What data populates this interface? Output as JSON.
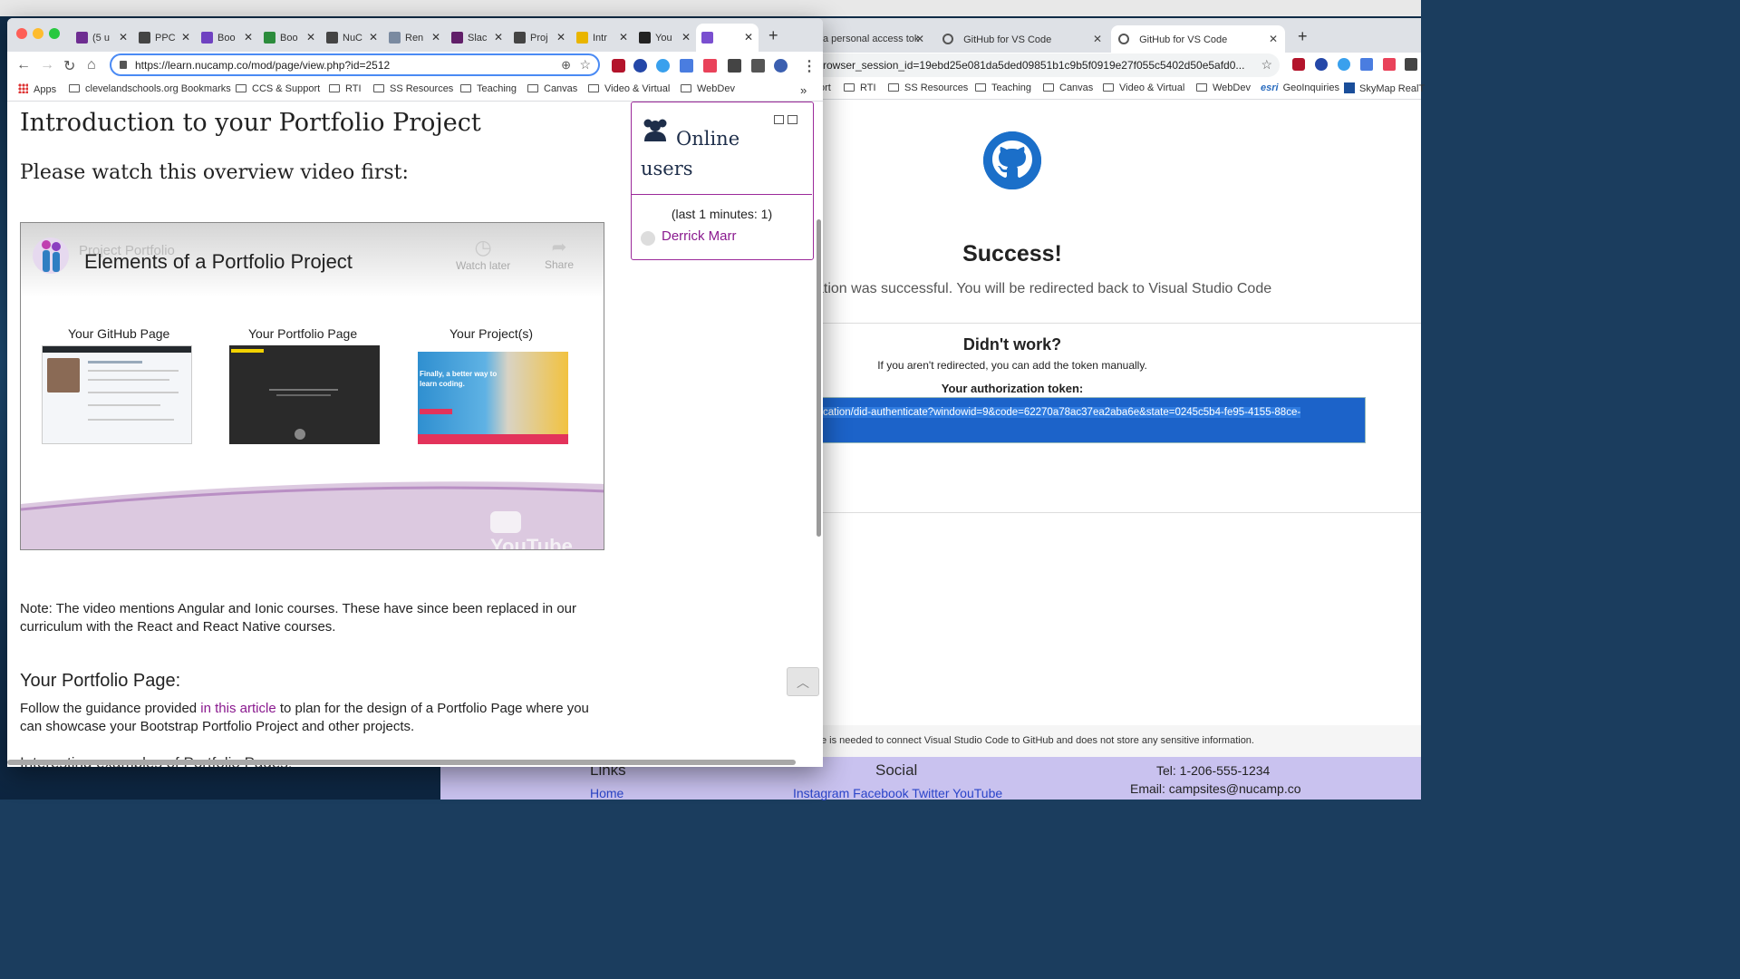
{
  "left_window": {
    "tabs": [
      {
        "label": "(5 u",
        "color": "#6e2d91"
      },
      {
        "label": "PPC",
        "color": "#444444"
      },
      {
        "label": "Boo",
        "color": "#6f42c1"
      },
      {
        "label": "Boo",
        "color": "#2c8c3c"
      },
      {
        "label": "NuC",
        "color": "#444444"
      },
      {
        "label": "Ren",
        "color": "#7a8aa0"
      },
      {
        "label": "Slac",
        "color": "#611f69"
      },
      {
        "label": "Proj",
        "color": "#444444"
      },
      {
        "label": "Intr",
        "color": "#e9b500"
      },
      {
        "label": "You",
        "color": "#222222"
      },
      {
        "label": "",
        "color": "#7a4fd0"
      }
    ],
    "url": "https://learn.nucamp.co/mod/page/view.php?id=2512",
    "bookmarks": {
      "apps": "Apps",
      "items": [
        "clevelandschools.org Bookmarks",
        "CCS & Support",
        "RTI",
        "SS Resources",
        "Teaching",
        "Canvas",
        "Video & Virtual",
        "WebDev"
      ],
      "more": "»"
    },
    "page": {
      "title": "Introduction to your Portfolio Project",
      "subtitle": "Please watch this overview video first:",
      "video": {
        "title": "Elements of a Portfolio Project",
        "ghost_title": "Project Portfolio",
        "watch_later": "Watch later",
        "share": "Share",
        "captions": [
          "Your GitHub Page",
          "Your Portfolio Page",
          "Your Project(s)"
        ],
        "youtube": "YouTube",
        "thumb3_text": "Finally, a better way to learn coding."
      },
      "note": "Note: The video mentions Angular and Ionic courses. These have since been replaced in our curriculum with the React and React Native courses.",
      "section_title": "Your Portfolio Page:",
      "follow_before": "Follow the guidance provided ",
      "follow_link": "in this article",
      "follow_after": " to plan for the design of a Portfolio Page where you can showcase your Bootstrap Portfolio Project and other projects.",
      "next_heading": "Interesting examples of Portfolio Pages:"
    },
    "online_users": {
      "title_line1": "Online",
      "title_line2": "users",
      "last": "(last 1 minutes: 1)",
      "user": "Derrick Marr"
    }
  },
  "right_window": {
    "tabs": [
      {
        "label": "a personal access tok"
      },
      {
        "label": "GitHub for VS Code"
      },
      {
        "label": "GitHub for VS Code"
      }
    ],
    "url": "rowser_session_id=19ebd25e081da5ded09851b1c9b5f0919e27f055c5402d50e5afd0...",
    "bookmarks": [
      "ort",
      "RTI",
      "SS Resources",
      "Teaching",
      "Canvas",
      "Video & Virtual",
      "WebDev",
      "GeoInquiries",
      "SkyMap RealT"
    ],
    "esri": "esri",
    "success": "Success!",
    "success_sub": "ation was successful. You will be redirected back to Visual Studio Code",
    "didnt_work": "Didn't work?",
    "if_not": "If you aren't redirected, you can add the token manually.",
    "auth_label": "Your authorization token:",
    "token": "cation/did-authenticate?windowid=9&code=62270a78ac37ea2aba6e&state=0245c5b4-fe95-4155-88ce-",
    "footer_note": "e is needed to connect Visual Studio Code to GitHub and does not store any sensitive information."
  },
  "background_page": {
    "links_heading": "Links",
    "social_heading": "Social",
    "home": "Home",
    "social_links": "Instagram Facebook Twitter YouTube",
    "tel": "Tel: 1-206-555-1234",
    "email": "Email: campsites@nucamp.co"
  }
}
